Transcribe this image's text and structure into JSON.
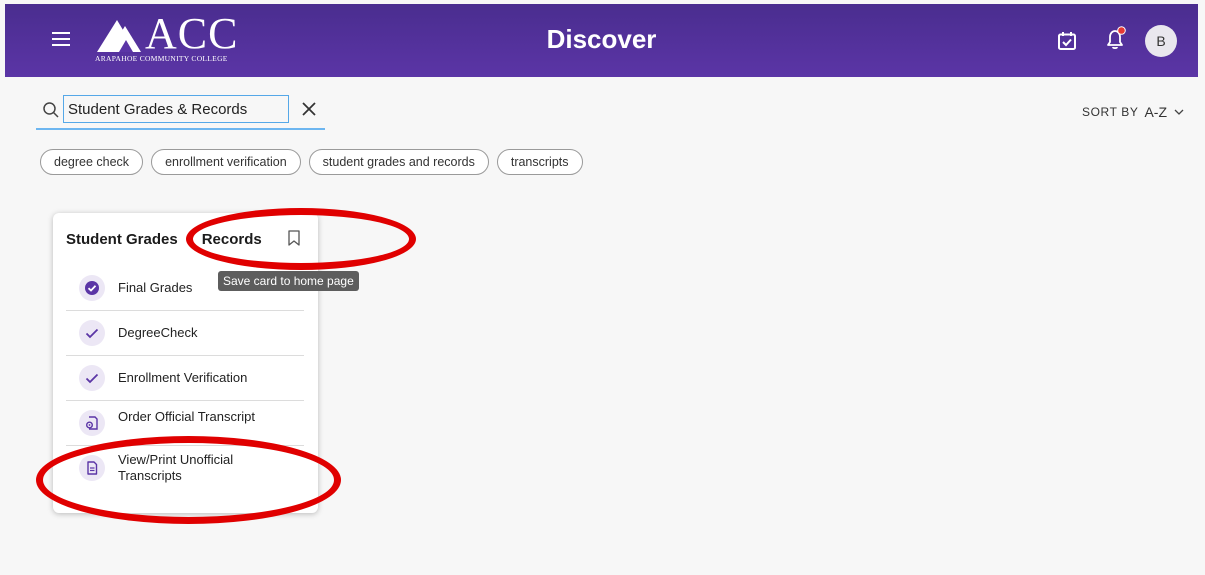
{
  "header": {
    "logo_text": "ACC",
    "logo_subtitle": "ARAPAHOE COMMUNITY COLLEGE",
    "title": "Discover",
    "avatar_initial": "B",
    "accent_color": "#4f2f98",
    "notification_dot_color": "#e53935"
  },
  "search": {
    "value": "Student Grades & Records",
    "placeholder": ""
  },
  "sort": {
    "label": "SORT BY",
    "value": "A-Z"
  },
  "chips": [
    {
      "label": "degree check"
    },
    {
      "label": "enrollment verification"
    },
    {
      "label": "student grades and records"
    },
    {
      "label": "transcripts"
    }
  ],
  "card": {
    "title_part1": "Student Grades",
    "title_part2": "Records",
    "bookmark_tooltip": "Save card to home page",
    "items": [
      {
        "label": "Final Grades",
        "icon": "check-circle-filled-icon"
      },
      {
        "label": "DegreeCheck",
        "icon": "check-icon"
      },
      {
        "label": "Enrollment Verification",
        "icon": "check-icon"
      },
      {
        "label": "Order Official Transcript",
        "icon": "document-gear-icon"
      },
      {
        "label": "View/Print Unofficial Transcripts",
        "icon": "document-icon"
      }
    ]
  },
  "annotation_color": "#e00000"
}
